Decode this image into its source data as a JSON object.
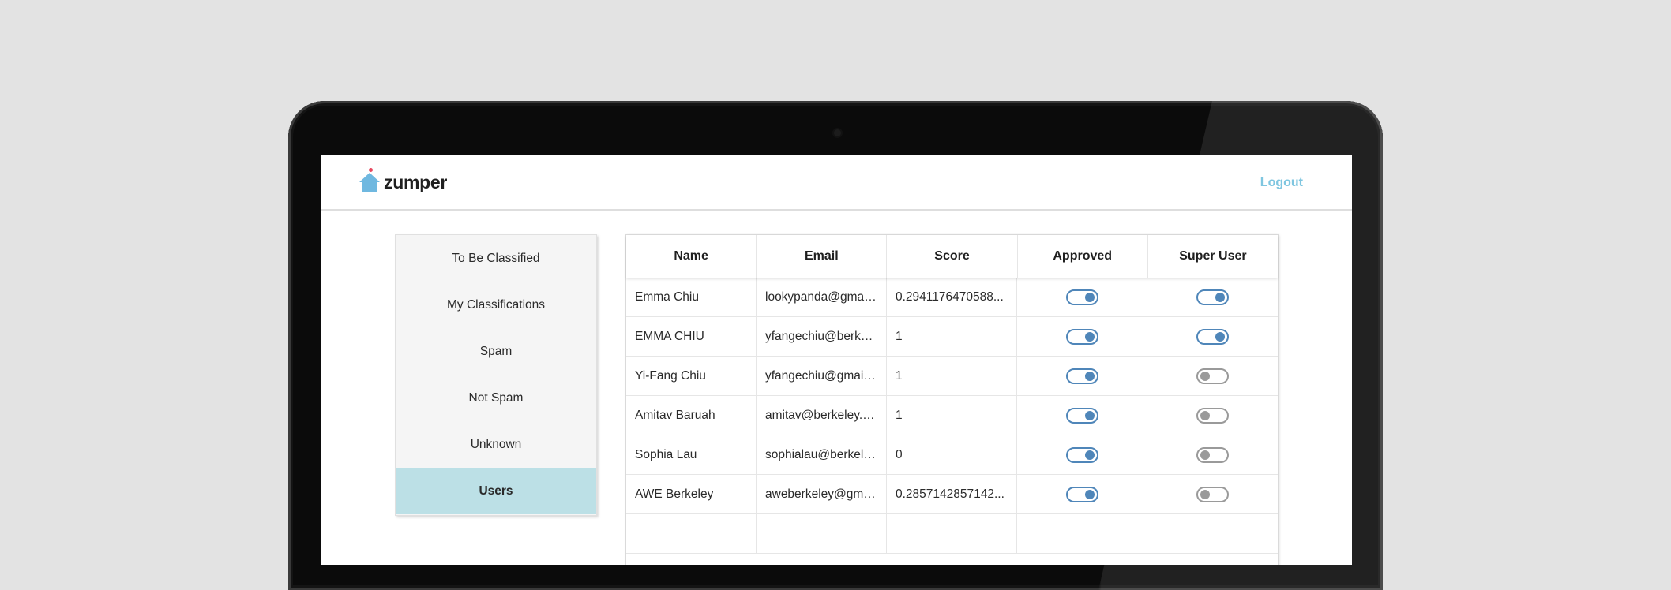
{
  "app": {
    "brand": "zumper",
    "logout_label": "Logout"
  },
  "sidebar": {
    "items": [
      {
        "label": "To Be Classified",
        "active": false
      },
      {
        "label": "My Classifications",
        "active": false
      },
      {
        "label": "Spam",
        "active": false
      },
      {
        "label": "Not Spam",
        "active": false
      },
      {
        "label": "Unknown",
        "active": false
      },
      {
        "label": "Users",
        "active": true
      }
    ]
  },
  "table": {
    "columns": [
      "Name",
      "Email",
      "Score",
      "Approved",
      "Super User"
    ],
    "rows": [
      {
        "name": "Emma Chiu",
        "email": "lookypanda@gmail...",
        "score": "0.2941176470588...",
        "approved": true,
        "super_user": true
      },
      {
        "name": "EMMA CHIU",
        "email": "yfangechiu@berkel...",
        "score": "1",
        "approved": true,
        "super_user": true
      },
      {
        "name": "Yi-Fang Chiu",
        "email": "yfangechiu@gmail....",
        "score": "1",
        "approved": true,
        "super_user": false
      },
      {
        "name": "Amitav Baruah",
        "email": "amitav@berkeley.e...",
        "score": "1",
        "approved": true,
        "super_user": false
      },
      {
        "name": "Sophia Lau",
        "email": "sophialau@berkele...",
        "score": "0",
        "approved": true,
        "super_user": false
      },
      {
        "name": "AWE Berkeley",
        "email": "aweberkeley@gmai...",
        "score": "0.2857142857142...",
        "approved": true,
        "super_user": false
      }
    ]
  },
  "colors": {
    "accent": "#4f86b9",
    "active_nav": "#bce0e6",
    "logout": "#7fc6e0",
    "logo_house": "#6fb8e0",
    "logo_dot": "#e8485f"
  }
}
